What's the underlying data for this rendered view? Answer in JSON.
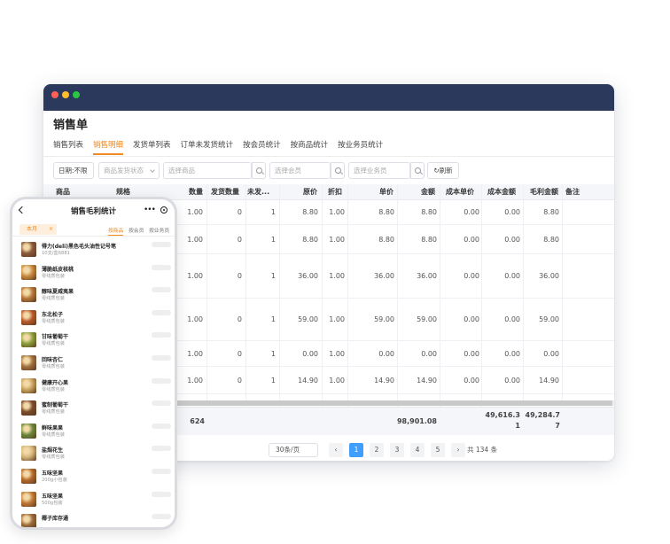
{
  "window": {
    "title": "销售单",
    "tabs": [
      "销售列表",
      "销售明细",
      "发货单列表",
      "订单未发货统计",
      "按会员统计",
      "按商品统计",
      "按业务员统计"
    ],
    "active_tab": 1,
    "filters": {
      "date": "日期:不限",
      "ship_status": "商品发货状态",
      "product_placeholder": "选择商品",
      "member_placeholder": "选择会员",
      "salesman_placeholder": "选择业务员",
      "refresh": "刷新"
    },
    "columns": {
      "product": "商品",
      "spec": "规格",
      "qty": "数量",
      "shipped": "发货数量",
      "unshipped": "未发...",
      "orig_price": "原价",
      "discount": "折扣",
      "unit_price": "单价",
      "amount": "金额",
      "cost_unit": "成本单价",
      "cost_amount": "成本金额",
      "gross_profit": "毛利金额",
      "remark": "备注"
    },
    "rows": [
      {
        "qty": "1.00",
        "shipped": "0",
        "unshipped": "1",
        "orig_price": "8.80",
        "discount": "1.00",
        "unit_price": "8.80",
        "amount": "8.80",
        "cost_unit": "0.00",
        "cost_amount": "0.00",
        "gross_profit": "8.80"
      },
      {
        "qty": "1.00",
        "shipped": "0",
        "unshipped": "1",
        "orig_price": "8.80",
        "discount": "1.00",
        "unit_price": "8.80",
        "amount": "8.80",
        "cost_unit": "0.00",
        "cost_amount": "0.00",
        "gross_profit": "8.80"
      },
      {
        "qty": "1.00",
        "shipped": "0",
        "unshipped": "1",
        "orig_price": "36.00",
        "discount": "1.00",
        "unit_price": "36.00",
        "amount": "36.00",
        "cost_unit": "0.00",
        "cost_amount": "0.00",
        "gross_profit": "36.00"
      },
      {
        "qty": "1.00",
        "shipped": "0",
        "unshipped": "1",
        "orig_price": "59.00",
        "discount": "1.00",
        "unit_price": "59.00",
        "amount": "59.00",
        "cost_unit": "0.00",
        "cost_amount": "0.00",
        "gross_profit": "59.00"
      },
      {
        "qty": "1.00",
        "shipped": "0",
        "unshipped": "1",
        "orig_price": "0.00",
        "discount": "1.00",
        "unit_price": "0.00",
        "amount": "0.00",
        "cost_unit": "0.00",
        "cost_amount": "0.00",
        "gross_profit": "0.00"
      },
      {
        "qty": "1.00",
        "shipped": "0",
        "unshipped": "1",
        "orig_price": "14.90",
        "discount": "1.00",
        "unit_price": "14.90",
        "amount": "14.90",
        "cost_unit": "0.00",
        "cost_amount": "0.00",
        "gross_profit": "14.90"
      }
    ],
    "totals": {
      "qty": "624",
      "amount": "98,901.08",
      "cost_amount": "49,616.3\n1",
      "gross_profit": "49,284.7\n7"
    },
    "pager": {
      "page_size": "30条/页",
      "pages": [
        "1",
        "2",
        "3",
        "4",
        "5"
      ],
      "active_page": 0,
      "total": "共 134 条",
      "prev": "‹",
      "next": "›"
    }
  },
  "phone": {
    "title": "销售毛利统计",
    "more": "•••",
    "filter_chip": "本月",
    "filter_close": "×",
    "sub_tabs": [
      "按商品",
      "按会员",
      "按业务员"
    ],
    "items": [
      {
        "name": "得力(deli)黑色毛头油性记号笔",
        "spec": "10支/盒6881"
      },
      {
        "name": "薄脆纸皮核桃",
        "spec": "零线质包装"
      },
      {
        "name": "醇味夏威夷果",
        "spec": "零线质包装"
      },
      {
        "name": "东北松子",
        "spec": "零线质包装"
      },
      {
        "name": "甘味葡萄干",
        "spec": "零线质包装"
      },
      {
        "name": "回味杏仁",
        "spec": "零线质包装"
      },
      {
        "name": "健康开心果",
        "spec": "零线质包装"
      },
      {
        "name": "蜜制葡萄干",
        "spec": "零线质包装"
      },
      {
        "name": "鲜味果果",
        "spec": "零线质包装"
      },
      {
        "name": "盐焗花生",
        "spec": "零线质包装"
      },
      {
        "name": "五味坚果",
        "spec": "200g小包装"
      },
      {
        "name": "五味坚果",
        "spec": "500g包装"
      },
      {
        "name": "椰子库存通",
        "spec": ""
      }
    ],
    "thumb_colors": [
      "#8a5a3b",
      "#c98a3e",
      "#b5773a",
      "#b85a2a",
      "#8aa13a",
      "#a0703e",
      "#c9a45e",
      "#7a4a2a",
      "#6a8a3a",
      "#d6b77a",
      "#b56a2a",
      "#c27a35",
      "#9a6a3a"
    ]
  }
}
